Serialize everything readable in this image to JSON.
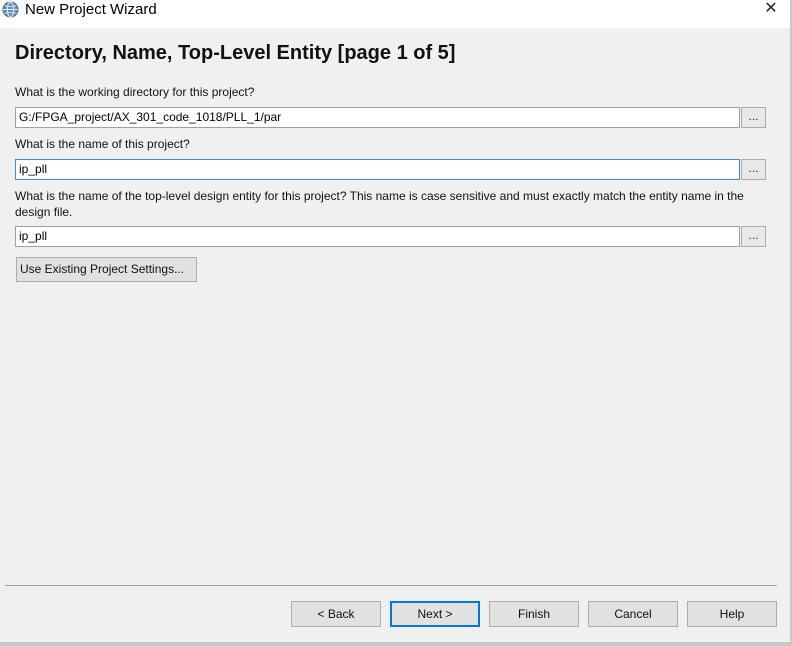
{
  "window": {
    "title": "New Project Wizard",
    "close_glyph": "✕",
    "app_icon": "quartus-globe-icon"
  },
  "page": {
    "heading": "Directory, Name, Top-Level Entity [page 1 of 5]"
  },
  "fields": {
    "directory": {
      "question": "What is the working directory for this project?",
      "value": "G:/FPGA_project/AX_301_code_1018/PLL_1/par",
      "browse_label": "..."
    },
    "project_name": {
      "question": "What is the name of this project?",
      "value": "ip_pll",
      "browse_label": "..."
    },
    "top_entity": {
      "question": "What is the name of the top-level design entity for this project? This name is case sensitive and must exactly match the entity name in the design file.",
      "value": "ip_pll",
      "browse_label": "..."
    }
  },
  "buttons": {
    "use_existing": "Use Existing Project Settings...",
    "back": "< Back",
    "next": "Next >",
    "finish": "Finish",
    "cancel": "Cancel",
    "help": "Help"
  },
  "colors": {
    "focus_border": "#3b8fd9",
    "default_button_border": "#0078d7",
    "background": "#f0f0f0"
  }
}
